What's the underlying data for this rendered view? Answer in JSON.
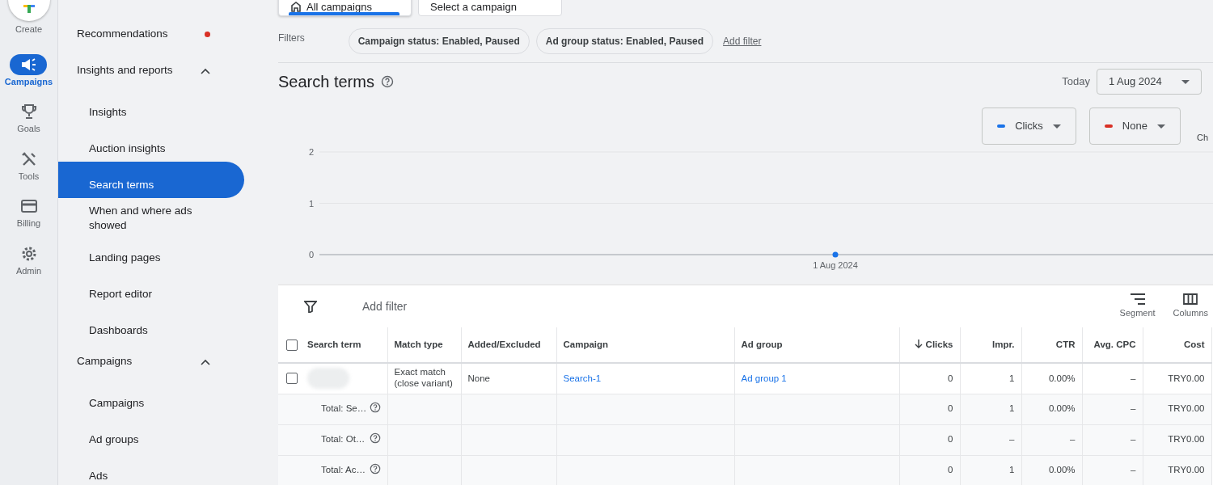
{
  "rail": {
    "create_label": "Create",
    "items": [
      {
        "label": "Campaigns",
        "selected": true
      },
      {
        "label": "Goals",
        "selected": false
      },
      {
        "label": "Tools",
        "selected": false
      },
      {
        "label": "Billing",
        "selected": false
      },
      {
        "label": "Admin",
        "selected": false
      }
    ]
  },
  "nav": [
    {
      "kind": "link",
      "label": "Recommendations",
      "selected": false,
      "alert": true
    },
    {
      "kind": "section",
      "label": "Insights and reports",
      "expanded": true,
      "children": [
        {
          "label": "Insights",
          "selected": false
        },
        {
          "label": "Auction insights",
          "selected": false
        },
        {
          "label": "Search terms",
          "selected": true
        },
        {
          "label": "When and where ads showed",
          "selected": false
        },
        {
          "label": "Landing pages",
          "selected": false
        },
        {
          "label": "Report editor",
          "selected": false
        },
        {
          "label": "Dashboards",
          "selected": false
        }
      ]
    },
    {
      "kind": "section",
      "label": "Campaigns",
      "expanded": true,
      "children": [
        {
          "label": "Campaigns",
          "selected": false
        },
        {
          "label": "Ad groups",
          "selected": false
        },
        {
          "label": "Ads",
          "selected": false
        }
      ]
    }
  ],
  "scope_tabs": [
    {
      "label": "All campaigns",
      "selected": true
    },
    {
      "label": "Select a campaign",
      "selected": false
    }
  ],
  "filters": {
    "label": "Filters",
    "chips": [
      "Campaign status: Enabled, Paused",
      "Ad group status: Enabled, Paused"
    ],
    "add_filter": "Add filter"
  },
  "page_title": "Search terms",
  "date": {
    "label": "Today",
    "value": "1 Aug 2024"
  },
  "second_metric": {
    "label": "None",
    "color": "#d93025"
  },
  "cut_label": "Ch",
  "chart_data": {
    "type": "line",
    "categories": [
      "1 Aug 2024"
    ],
    "series": [
      {
        "name": "Clicks",
        "color": "#1a73e8",
        "marker": true,
        "values": [
          0
        ]
      }
    ],
    "yticks": [
      0,
      1,
      2
    ],
    "ylim": [
      0,
      2
    ]
  },
  "table": {
    "add_filter": "Add filter",
    "select_all_checked": false,
    "actions": [
      {
        "label": "Segment"
      },
      {
        "label": "Columns"
      }
    ],
    "columns": [
      {
        "label": "Search term",
        "sorted": false
      },
      {
        "label": "Match type",
        "sorted": false
      },
      {
        "label": "Added/Excluded",
        "sorted": false
      },
      {
        "label": "Campaign",
        "sorted": false
      },
      {
        "label": "Ad group",
        "sorted": false
      },
      {
        "label": "Clicks",
        "sorted": true
      },
      {
        "label": "Impr.",
        "sorted": false
      },
      {
        "label": "CTR",
        "sorted": false
      },
      {
        "label": "Avg. CPC",
        "sorted": false
      },
      {
        "label": "Cost",
        "sorted": false
      }
    ],
    "rows": [
      {
        "kind": "data",
        "checked": false,
        "match_type": "Exact match (close variant)",
        "added_excluded": "None",
        "campaign": "Search-1",
        "ad_group": "Ad group 1",
        "clicks": "0",
        "impr": "1",
        "ctr": "0.00%",
        "avg_cpc": "–",
        "cost": "TRY0.00"
      },
      {
        "kind": "total",
        "label": "Total: Se…",
        "clicks": "0",
        "impr": "1",
        "ctr": "0.00%",
        "avg_cpc": "–",
        "cost": "TRY0.00"
      },
      {
        "kind": "total",
        "label": "Total: Ot…",
        "clicks": "0",
        "impr": "–",
        "ctr": "–",
        "avg_cpc": "–",
        "cost": "TRY0.00"
      },
      {
        "kind": "total",
        "label": "Total: Ac…",
        "clicks": "0",
        "impr": "1",
        "ctr": "0.00%",
        "avg_cpc": "–",
        "cost": "TRY0.00"
      }
    ]
  }
}
